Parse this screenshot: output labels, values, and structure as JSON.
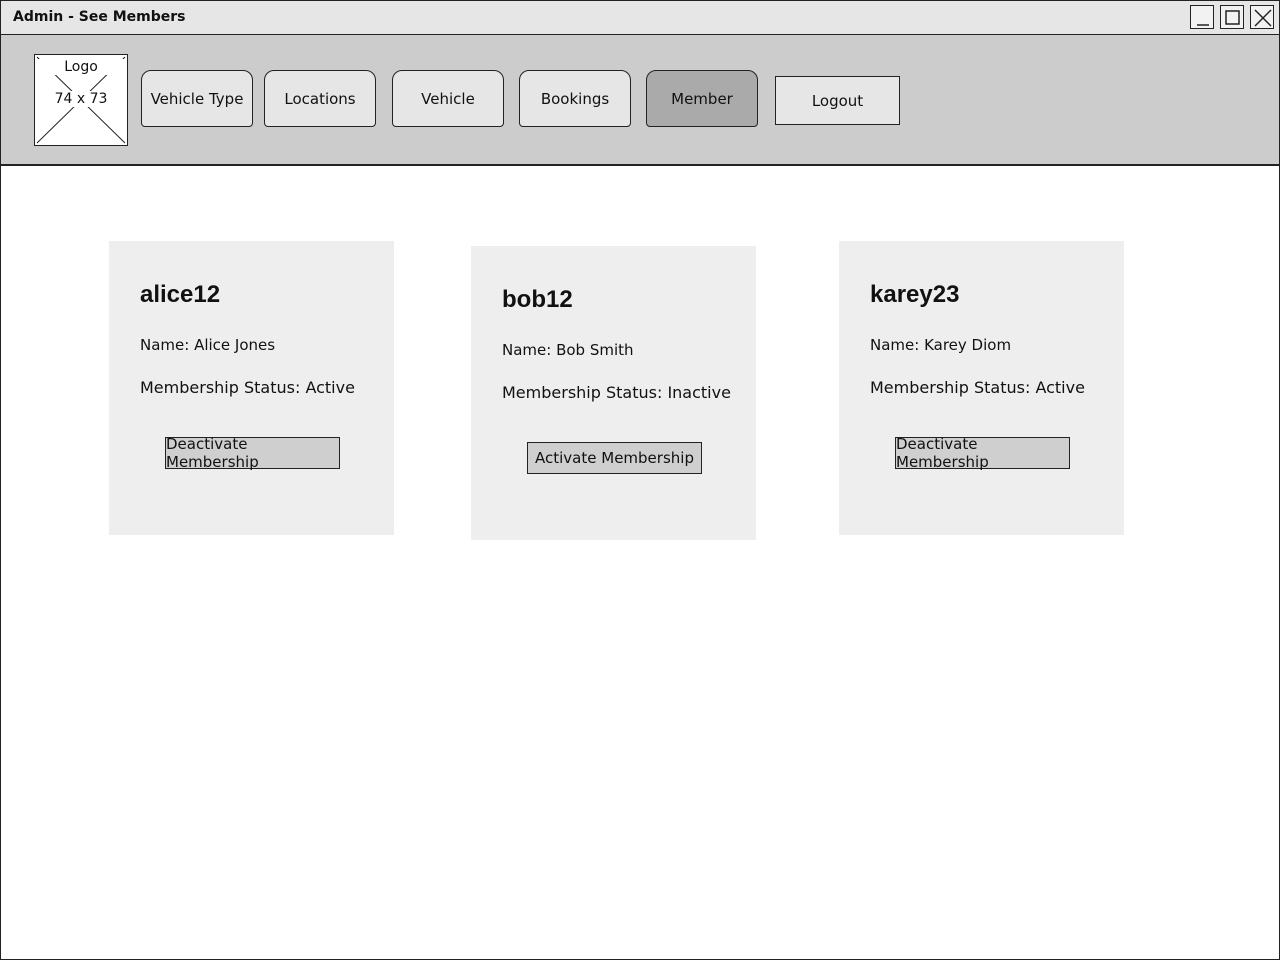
{
  "window": {
    "title": "Admin - See Members"
  },
  "logo": {
    "label": "Logo",
    "dimensions": "74 x 73"
  },
  "nav": {
    "tabs": [
      {
        "label": "Vehicle Type",
        "active": false
      },
      {
        "label": "Locations",
        "active": false
      },
      {
        "label": "Vehicle",
        "active": false
      },
      {
        "label": "Bookings",
        "active": false
      },
      {
        "label": "Member",
        "active": true
      }
    ],
    "logout_label": "Logout"
  },
  "members": [
    {
      "username": "alice12",
      "name": "Name: Alice Jones",
      "status": "Membership Status: Active",
      "action": "Deactivate Membership"
    },
    {
      "username": "bob12",
      "name": "Name: Bob Smith",
      "status": "Membership Status: Inactive",
      "action": "Activate Membership"
    },
    {
      "username": "karey23",
      "name": "Name: Karey Diom",
      "status": "Membership Status: Active",
      "action": "Deactivate Membership"
    }
  ]
}
